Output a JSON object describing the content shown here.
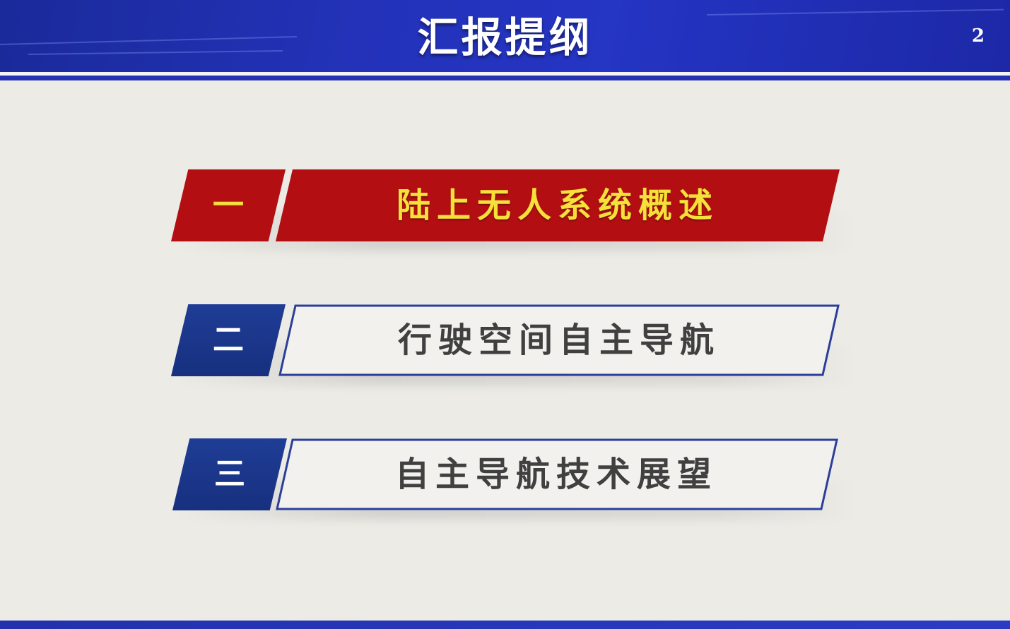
{
  "header": {
    "title": "汇报提纲",
    "page_number": "2"
  },
  "outline": {
    "items": [
      {
        "number": "一",
        "label": "陆上无人系统概述",
        "active": true
      },
      {
        "number": "二",
        "label": "行驶空间自主导航",
        "active": false
      },
      {
        "number": "三",
        "label": "自主导航技术展望",
        "active": false
      }
    ]
  },
  "colors": {
    "header_blue": "#2332b8",
    "active_red": "#b30f12",
    "active_text_yellow": "#f5e13a",
    "number_box_blue": "#1f3d96",
    "inactive_text": "#404040",
    "background": "#ecebe6"
  }
}
